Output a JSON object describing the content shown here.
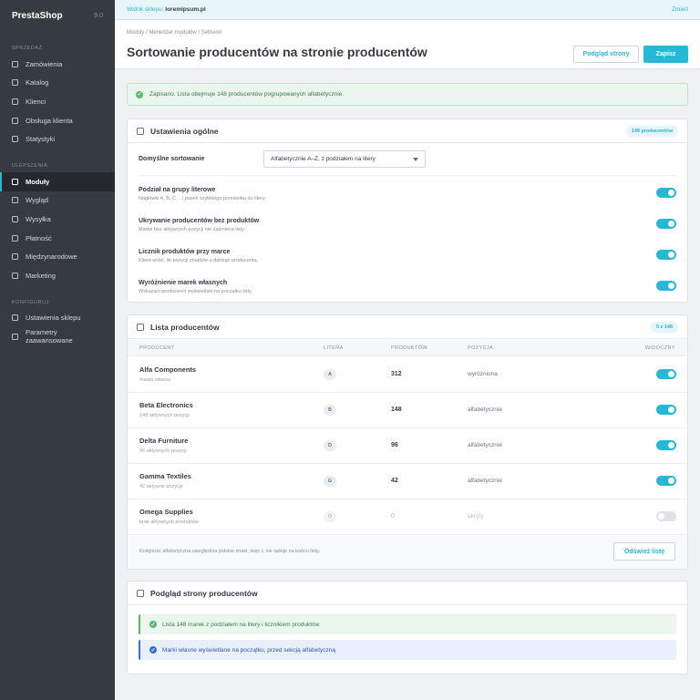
{
  "sidebar": {
    "brand": "PrestaShop",
    "version": "9.0",
    "sections": [
      {
        "title": "SPRZEDAŻ",
        "items": [
          "Zamówienia",
          "Katalog",
          "Klienci",
          "Obsługa klienta",
          "Statystyki"
        ]
      },
      {
        "title": "ULEPSZENIA",
        "items": [
          "Moduły",
          "Wygląd",
          "Wysyłka",
          "Płatność",
          "Międzynarodowe",
          "Marketing"
        ]
      },
      {
        "title": "KONFIGURUJ",
        "items": [
          "Ustawienia sklepu",
          "Parametry zaawansowane"
        ]
      }
    ],
    "active_item": "Moduły"
  },
  "topbar": {
    "shop_label": "Widok sklepu:",
    "shop_name": "loremipsum.pl",
    "change": "Zmień"
  },
  "header": {
    "breadcrumb": "Moduły  /  Menedżer modułów  /  Sellision",
    "title": "Sortowanie producentów na stronie producentów",
    "preview_button": "Podgląd strony",
    "save_button": "Zapisz"
  },
  "alert": {
    "text": "Zapisano. Lista obejmuje 148 producentów pogrupowanych alfabetycznie."
  },
  "general": {
    "title": "Ustawienia ogólne",
    "badge": "148 producentów",
    "default_sort_label": "Domyślne sortowanie",
    "default_sort_value": "Alfabetycznie A–Z, z podziałem na litery",
    "settings": [
      {
        "label": "Podział na grupy literowe",
        "desc": "Nagłówki A, B, C… i pasek szybkiego przeskoku do litery.",
        "on": true
      },
      {
        "label": "Ukrywanie producentów bez produktów",
        "desc": "Marka bez aktywnych pozycji nie zaśmieca listy.",
        "on": true
      },
      {
        "label": "Licznik produktów przy marce",
        "desc": "Klient widzi, ile pozycji znajdzie u danego producenta.",
        "on": true
      },
      {
        "label": "Wyróżnienie marek własnych",
        "desc": "Wskazani producenci wyświetlani na początku listy.",
        "on": true
      }
    ]
  },
  "list": {
    "title": "Lista producentów",
    "badge": "5 z 148",
    "columns": {
      "producer": "PRODUCENT",
      "letter": "LITERA",
      "products": "PRODUKTÓW",
      "position": "POZYCJA",
      "visible": "WIDOCZNY"
    },
    "rows": [
      {
        "name": "Alfa Components",
        "sub": "marka własna",
        "letter": "A",
        "count": "312",
        "position": "wyróżniona",
        "visible": true
      },
      {
        "name": "Beta Electronics",
        "sub": "148 aktywnych pozycji",
        "letter": "B",
        "count": "148",
        "position": "alfabetycznie",
        "visible": true
      },
      {
        "name": "Delta Furniture",
        "sub": "96 aktywnych pozycji",
        "letter": "D",
        "count": "96",
        "position": "alfabetycznie",
        "visible": true
      },
      {
        "name": "Gamma Textiles",
        "sub": "42 aktywne pozycje",
        "letter": "G",
        "count": "42",
        "position": "alfabetycznie",
        "visible": true
      },
      {
        "name": "Omega Supplies",
        "sub": "brak aktywnych produktów",
        "letter": "O",
        "count": "0",
        "position": "ukryty",
        "visible": false
      }
    ],
    "footer_note": "Kolejność alfabetyczna uwzględnia polskie znaki, więc Ł nie ląduje na końcu listy.",
    "refresh_button": "Odśwież listę"
  },
  "preview": {
    "title": "Podgląd strony producentów",
    "notes": [
      {
        "text": "Lista 148 marek z podziałem na litery i licznikiem produktów",
        "kind": "success"
      },
      {
        "text": "Marki własne wyświetlane na początku, przed sekcją alfabetyczną",
        "kind": "info"
      }
    ]
  }
}
